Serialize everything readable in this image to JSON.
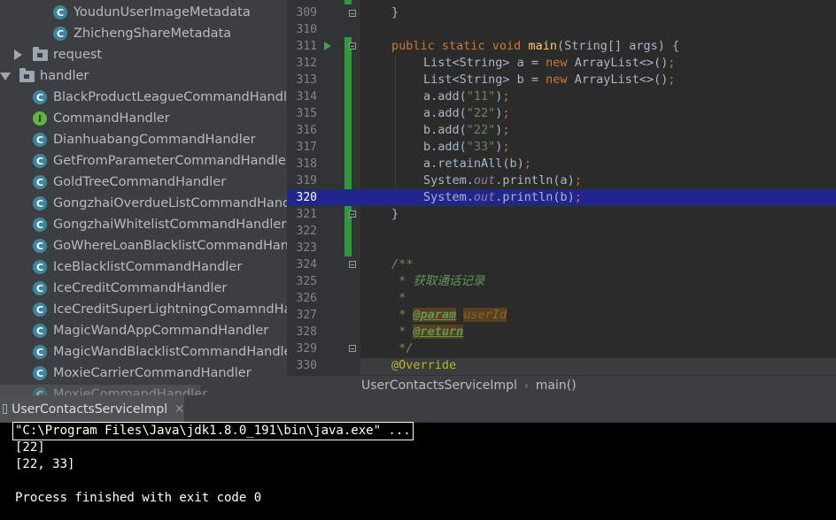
{
  "tree": {
    "items": [
      {
        "kind": "class",
        "label": "YoudunUserImageMetadata"
      },
      {
        "kind": "class",
        "label": "ZhichengShareMetadata"
      },
      {
        "kind": "package-collapsed",
        "label": "request"
      },
      {
        "kind": "package-expanded",
        "label": "handler"
      },
      {
        "kind": "class",
        "label": "BlackProductLeagueCommandHandler"
      },
      {
        "kind": "interface",
        "label": "CommandHandler"
      },
      {
        "kind": "class",
        "label": "DianhuabangCommandHandler"
      },
      {
        "kind": "class",
        "label": "GetFromParameterCommandHandler"
      },
      {
        "kind": "class",
        "label": "GoldTreeCommandHandler"
      },
      {
        "kind": "class",
        "label": "GongzhaiOverdueListCommandHandle"
      },
      {
        "kind": "class",
        "label": "GongzhaiWhitelistCommandHandler"
      },
      {
        "kind": "class",
        "label": "GoWhereLoanBlacklistCommandHandl"
      },
      {
        "kind": "class",
        "label": "IceBlacklistCommandHandler"
      },
      {
        "kind": "class",
        "label": "IceCreditCommandHandler"
      },
      {
        "kind": "class",
        "label": "IceCreditSuperLightningComamndHan"
      },
      {
        "kind": "class",
        "label": "MagicWandAppCommandHandler"
      },
      {
        "kind": "class",
        "label": "MagicWandBlacklistCommandHandler"
      },
      {
        "kind": "class",
        "label": "MoxieCarrierCommandHandler"
      },
      {
        "kind": "class",
        "label": "MoxieCommandHandler"
      }
    ],
    "class_icon_letter": "C",
    "interface_icon_letter": "I"
  },
  "editor": {
    "current_line": "320",
    "lines": [
      {
        "no": "309"
      },
      {
        "no": "310"
      },
      {
        "no": "311"
      },
      {
        "no": "312"
      },
      {
        "no": "313"
      },
      {
        "no": "314"
      },
      {
        "no": "315"
      },
      {
        "no": "316"
      },
      {
        "no": "317"
      },
      {
        "no": "318"
      },
      {
        "no": "319"
      },
      {
        "no": "320"
      },
      {
        "no": "321"
      },
      {
        "no": "322"
      },
      {
        "no": "323"
      },
      {
        "no": "324"
      },
      {
        "no": "325"
      },
      {
        "no": "326"
      },
      {
        "no": "327"
      },
      {
        "no": "328"
      },
      {
        "no": "329"
      },
      {
        "no": "330"
      }
    ],
    "code": {
      "l309": "}",
      "l311_kw": "public static void ",
      "l311_meth": "main",
      "l311_rest": "(String[] args) {",
      "l312_a": "List<String> a = ",
      "l312_kw": "new ",
      "l312_b": "ArrayList<>()",
      "l313_a": "List<String> b = ",
      "l313_kw": "new ",
      "l313_b": "ArrayList<>()",
      "semi": ";",
      "l314_a": "a.add(",
      "l314_s": "\"11\"",
      "l315_a": "a.add(",
      "l315_s": "\"22\"",
      "l316_a": "b.add(",
      "l316_s": "\"22\"",
      "l317_a": "b.add(",
      "l317_s": "\"33\"",
      "l318": "a.retainAll(b)",
      "l319_a": "System.",
      "l319_f": "out",
      "l319_b": ".println(a)",
      "l320_a": "System.",
      "l320_f": "out",
      "l320_b": ".println(b)",
      "close_paren": ")",
      "l321": "}",
      "l324": "/**",
      "l325": " * 获取通话记录",
      "l326": " *",
      "l327_star": " * ",
      "l327_tag": "@param",
      "l327_val": "userId",
      "l328_star": " * ",
      "l328_tag": "@return",
      "l329": " */",
      "l330": "@Override"
    }
  },
  "breadcrumb": {
    "class_name": "UserContactsServiceImpl",
    "separator": "›",
    "method": "main()"
  },
  "run_panel": {
    "tab_label": "UserContactsServiceImpl",
    "close_glyph": "×",
    "console_lines": [
      "\"C:\\Program Files\\Java\\jdk1.8.0_191\\bin\\java.exe\" ...",
      "[22]",
      "[22, 33]",
      "",
      "Process finished with exit code 0"
    ]
  },
  "colors": {
    "keyword": "#cc7832",
    "string": "#6a8759",
    "current_line_bg": "#21268f",
    "vcs_changed": "#2b9b3e",
    "class_icon": "#3e86a0",
    "interface_icon": "#62b543"
  }
}
